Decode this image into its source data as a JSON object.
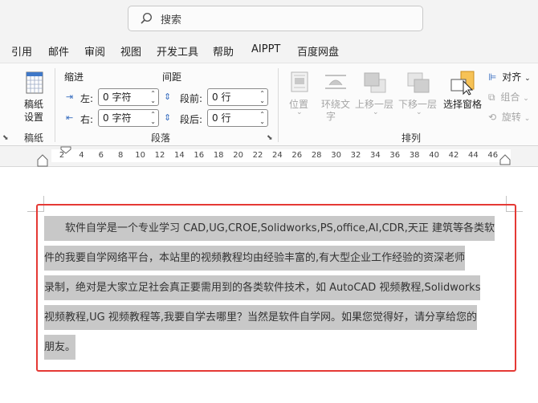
{
  "search": {
    "placeholder": "搜索"
  },
  "menu_tabs": [
    "引用",
    "邮件",
    "审阅",
    "视图",
    "开发工具",
    "帮助",
    "AIPPT",
    "百度网盘"
  ],
  "ribbon": {
    "gaozhi": {
      "button_line1": "稿纸",
      "button_line2": "设置",
      "group_label": "稿纸"
    },
    "paragraph": {
      "indent_title": "缩进",
      "spacing_title": "间距",
      "left_label": "左:",
      "right_label": "右:",
      "left_value": "0 字符",
      "right_value": "0 字符",
      "before_label": "段前:",
      "after_label": "段后:",
      "before_value": "0 行",
      "after_value": "0 行",
      "group_label": "段落"
    },
    "arrange": {
      "position_label": "位置",
      "wrap_line1": "环绕文",
      "wrap_line2": "字",
      "bring_forward": "上移一层",
      "send_backward": "下移一层",
      "selection_pane": "选择窗格",
      "align": "对齐",
      "group": "组合",
      "rotate": "旋转",
      "group_label": "排列"
    }
  },
  "ruler": {
    "labels": [
      "2",
      "4",
      "6",
      "8",
      "10",
      "12",
      "14",
      "16",
      "18",
      "20",
      "22",
      "24",
      "26",
      "28",
      "30",
      "32",
      "34",
      "36",
      "38",
      "40",
      "42",
      "44",
      "46"
    ]
  },
  "document": {
    "lines": [
      "软件自学是一个专业学习 CAD,UG,CROE,Solidworks,PS,office,AI,CDR,天正 建筑等各类软",
      "件的我要自学网络平台，本站里的视频教程均由经验丰富的,有大型企业工作经验的资深老师",
      "录制，绝对是大家立足社会真正要需用到的各类软件技术，如 AutoCAD 视频教程,Solidworks",
      "视频教程,UG 视频教程等,我要自学去哪里？当然是软件自学网。如果您觉得好，请分享给您的",
      "朋友。"
    ]
  },
  "colors": {
    "selection_highlight": "#c8c8c8",
    "annotation_box": "#e53935"
  }
}
